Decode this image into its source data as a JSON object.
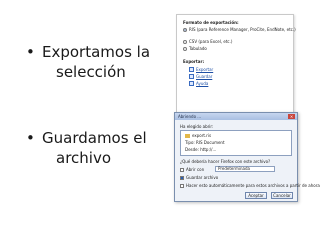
{
  "bullets": [
    {
      "marker": "•",
      "line1": "Exportamos la",
      "line2": "selección"
    },
    {
      "marker": "•",
      "line1": "Guardamos el",
      "line2": "archivo"
    }
  ],
  "export_panel": {
    "format_heading": "Formato de exportación:",
    "formats": [
      {
        "label": "RIS (para Reference Manager, ProCite, EndNote, etc.)",
        "selected": true
      },
      {
        "label": "CSV (para Excel, etc.)",
        "selected": false
      },
      {
        "label": "Tabulado",
        "selected": false
      }
    ],
    "export_heading": "Exportar:",
    "actions": [
      "Exportar",
      "Guardar",
      "Ayuda"
    ]
  },
  "save_dialog": {
    "title": "Abriendo ...",
    "intro": "Ha elegido abrir:",
    "file_name": "export.ris",
    "file_type": "Tipo: RIS Document",
    "from": "Desde: http://...",
    "question": "¿Qué debería hacer Firefox con este archivo?",
    "open_with_label": "Abrir con",
    "open_with_value": "Predeterminada",
    "save_label": "Guardar archivo",
    "remember_label": "Hacer esto automáticamente para estos archivos a partir de ahora",
    "ok_label": "Aceptar",
    "cancel_label": "Cancelar",
    "close_glyph": "×"
  }
}
